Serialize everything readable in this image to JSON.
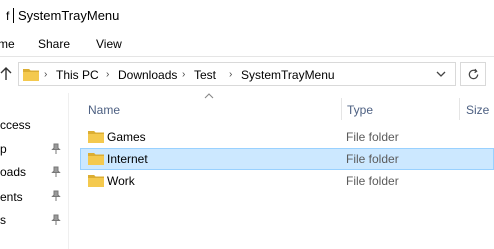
{
  "window": {
    "title": "SystemTrayMenu",
    "title_prefix": "f"
  },
  "ribbon": {
    "tabs": [
      "me",
      "Share",
      "View"
    ]
  },
  "address": {
    "crumbs": [
      "This PC",
      "Downloads",
      "Test",
      "SystemTrayMenu"
    ]
  },
  "left_pane": {
    "items": [
      "ccess",
      "p",
      "oads",
      "ents",
      "s"
    ]
  },
  "columns": {
    "name": "Name",
    "type": "Type",
    "size": "Size"
  },
  "rows": [
    {
      "name": "Games",
      "type": "File folder",
      "selected": false
    },
    {
      "name": "Internet",
      "type": "File folder",
      "selected": true
    },
    {
      "name": "Work",
      "type": "File folder",
      "selected": false
    }
  ],
  "colors": {
    "folder": "#f4c94e",
    "folder_dark": "#dcae33",
    "selection": "#cce8ff",
    "selection_border": "#99d1ff",
    "header_text": "#4d6082"
  },
  "icons": {
    "up": "up-arrow-icon",
    "refresh": "refresh-icon",
    "pin": "pin-icon",
    "folder": "folder-icon"
  }
}
